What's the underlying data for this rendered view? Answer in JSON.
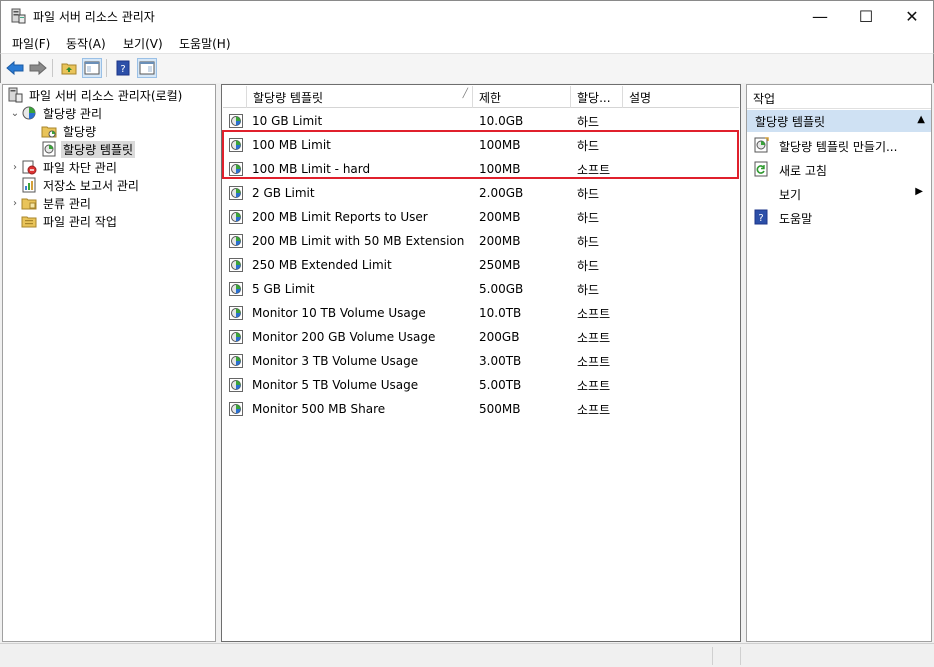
{
  "window": {
    "title": "파일 서버 리소스 관리자",
    "minimize_glyph": "—",
    "maximize_glyph": "☐",
    "close_glyph": "✕"
  },
  "menu": [
    {
      "label": "파일(F)"
    },
    {
      "label": "동작(A)"
    },
    {
      "label": "보기(V)"
    },
    {
      "label": "도움말(H)"
    }
  ],
  "toolbar": {
    "icons": [
      "back-arrow-icon",
      "forward-arrow-icon",
      "up-folder-icon",
      "show-tree-icon",
      "help-icon",
      "action-pane-icon"
    ]
  },
  "tree": [
    {
      "label": "파일 서버 리소스 관리자(로컬)",
      "icon": "server-icon",
      "expander": "",
      "level": 0
    },
    {
      "label": "할당량 관리",
      "icon": "quota-management-icon",
      "expander": "⌄",
      "level": 1
    },
    {
      "label": "할당량",
      "icon": "quota-folder-icon",
      "expander": "",
      "level": 2
    },
    {
      "label": "할당량 템플릿",
      "icon": "quota-template-icon",
      "expander": "",
      "level": 2,
      "selected": true
    },
    {
      "label": "파일 차단 관리",
      "icon": "file-screen-icon",
      "expander": "›",
      "level": 1
    },
    {
      "label": "저장소 보고서 관리",
      "icon": "storage-report-icon",
      "expander": "",
      "level": 1
    },
    {
      "label": "분류 관리",
      "icon": "classification-icon",
      "expander": "›",
      "level": 1
    },
    {
      "label": "파일 관리 작업",
      "icon": "file-task-icon",
      "expander": "",
      "level": 1
    }
  ],
  "list": {
    "columns": [
      {
        "label": "할당량 템플릿"
      },
      {
        "label": "제한"
      },
      {
        "label": "할당..."
      },
      {
        "label": "설명"
      }
    ],
    "rows": [
      {
        "name": "10 GB Limit",
        "limit": "10.0GB",
        "type": "하드",
        "desc": ""
      },
      {
        "name": "100 MB Limit",
        "limit": "100MB",
        "type": "하드",
        "desc": ""
      },
      {
        "name": "100 MB Limit - hard",
        "limit": "100MB",
        "type": "소프트",
        "desc": ""
      },
      {
        "name": "2 GB Limit",
        "limit": "2.00GB",
        "type": "하드",
        "desc": ""
      },
      {
        "name": "200 MB Limit Reports to User",
        "limit": "200MB",
        "type": "하드",
        "desc": ""
      },
      {
        "name": "200 MB Limit with 50 MB Extension",
        "limit": "200MB",
        "type": "하드",
        "desc": ""
      },
      {
        "name": "250 MB Extended Limit",
        "limit": "250MB",
        "type": "하드",
        "desc": ""
      },
      {
        "name": "5 GB Limit",
        "limit": "5.00GB",
        "type": "하드",
        "desc": ""
      },
      {
        "name": "Monitor 10 TB Volume Usage",
        "limit": "10.0TB",
        "type": "소프트",
        "desc": ""
      },
      {
        "name": "Monitor 200 GB Volume Usage",
        "limit": "200GB",
        "type": "소프트",
        "desc": ""
      },
      {
        "name": "Monitor 3 TB Volume Usage",
        "limit": "3.00TB",
        "type": "소프트",
        "desc": ""
      },
      {
        "name": "Monitor 5 TB Volume Usage",
        "limit": "5.00TB",
        "type": "소프트",
        "desc": ""
      },
      {
        "name": "Monitor 500 MB Share",
        "limit": "500MB",
        "type": "소프트",
        "desc": ""
      }
    ]
  },
  "actions": {
    "header": "작업",
    "section": "할당량 템플릿",
    "section_arrow": "▲",
    "items": [
      {
        "label": "할당량 템플릿 만들기...",
        "icon": "create-template-icon",
        "submenu": ""
      },
      {
        "label": "새로 고침",
        "icon": "refresh-icon",
        "submenu": ""
      },
      {
        "label": "보기",
        "icon": "",
        "submenu": "▶"
      },
      {
        "label": "도움말",
        "icon": "help-icon",
        "submenu": ""
      }
    ]
  },
  "colors": {
    "highlight_border": "#e0202c",
    "selection_bg": "#dadada",
    "section_bg": "#cfe1f3"
  }
}
